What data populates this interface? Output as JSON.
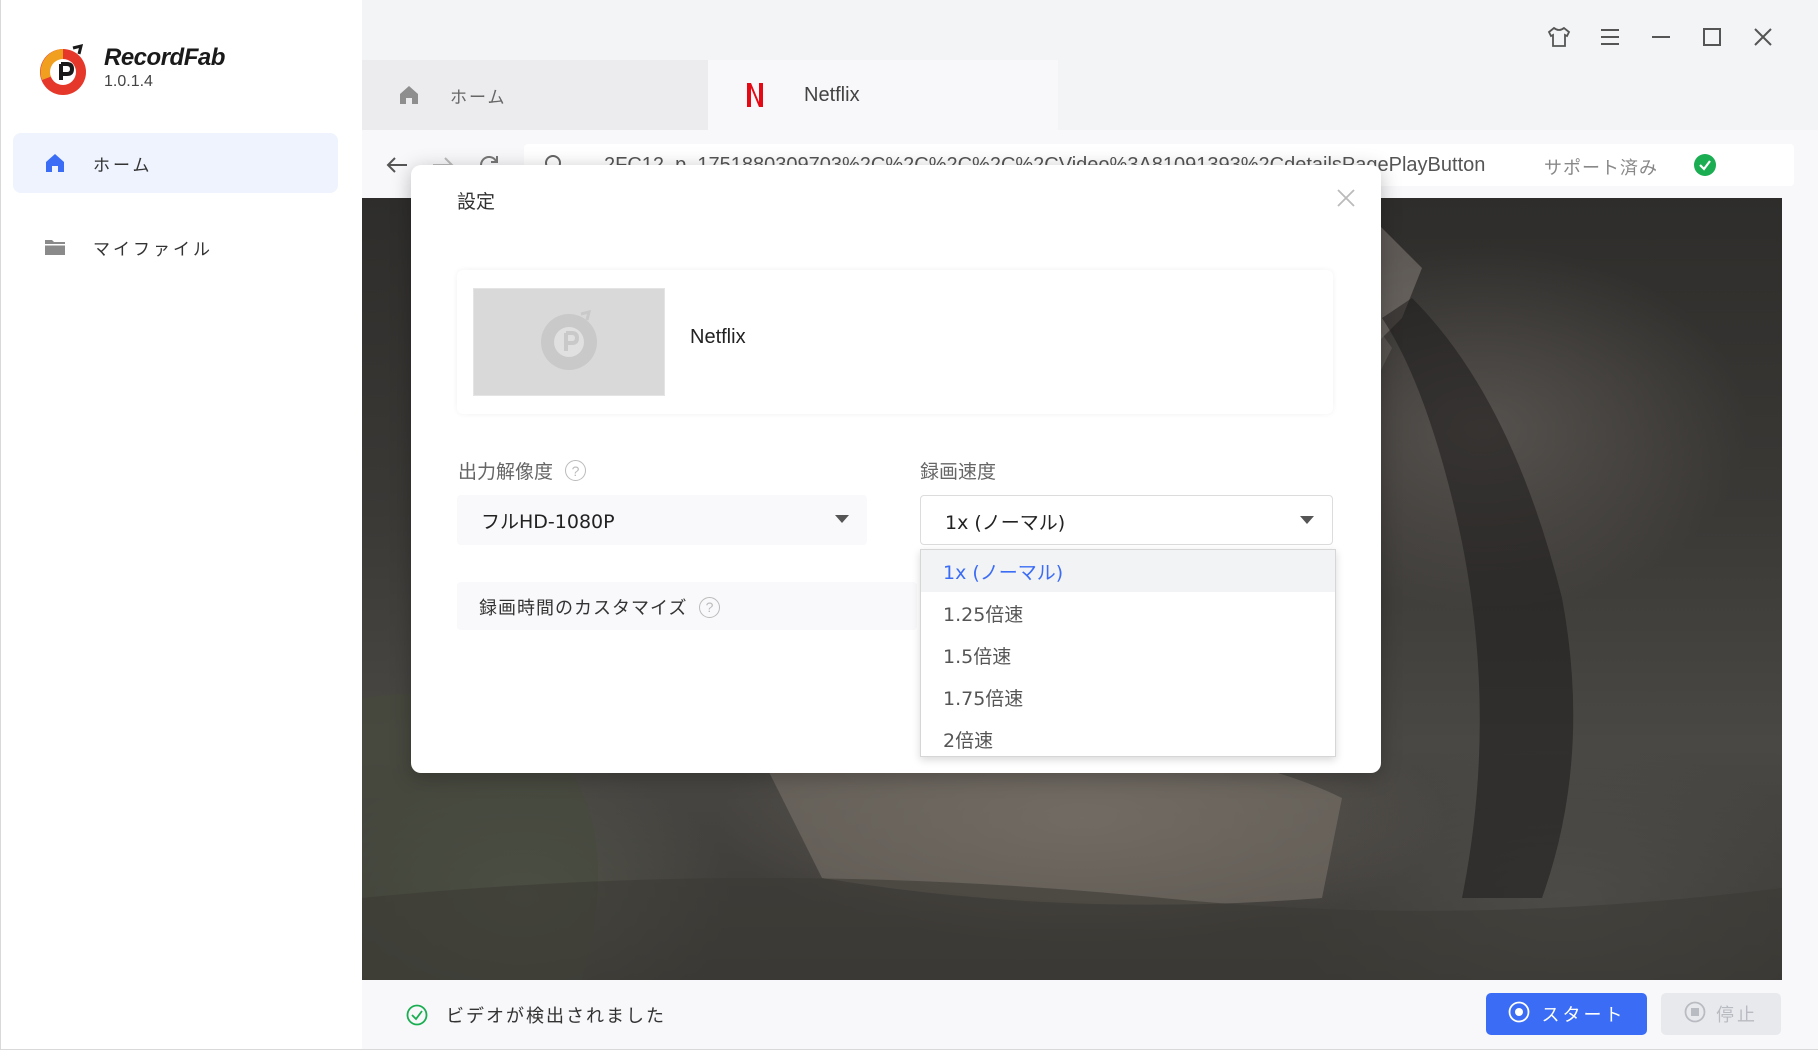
{
  "app": {
    "name": "RecordFab",
    "version": "1.0.1.4"
  },
  "sidebar": {
    "items": [
      {
        "label": "ホーム",
        "icon": "home-icon",
        "active": true
      },
      {
        "label": "マイファイル",
        "icon": "folder-icon",
        "active": false
      }
    ]
  },
  "tabs": [
    {
      "label": "ホーム",
      "icon": "home-icon"
    },
    {
      "label": "Netflix",
      "icon": "netflix-logo"
    }
  ],
  "address": {
    "url": "2FC12_p_1751880309703%2C%2C%2C%2C%2CVideo%3A81091393%2CdetailsPagePlayButton",
    "support_label": "サポート済み"
  },
  "status": {
    "detected_text": "ビデオが検出されました"
  },
  "buttons": {
    "start": "スタート",
    "stop": "停止"
  },
  "dialog": {
    "title": "設定",
    "media_title": "Netflix",
    "resolution": {
      "label": "出力解像度",
      "value": "フルHD-1080P"
    },
    "speed": {
      "label": "録画速度",
      "value": "1x (ノーマル)",
      "options": [
        "1x (ノーマル)",
        "1.25倍速",
        "1.5倍速",
        "1.75倍速",
        "2倍速"
      ],
      "selected_index": 0
    },
    "custom_time_label": "録画時間のカスタマイズ"
  },
  "colors": {
    "accent": "#3b6cf6",
    "support_check": "#1aad52",
    "netflix_red": "#e50914",
    "logo_orange": "#f0a01e",
    "logo_red": "#e5372a"
  }
}
